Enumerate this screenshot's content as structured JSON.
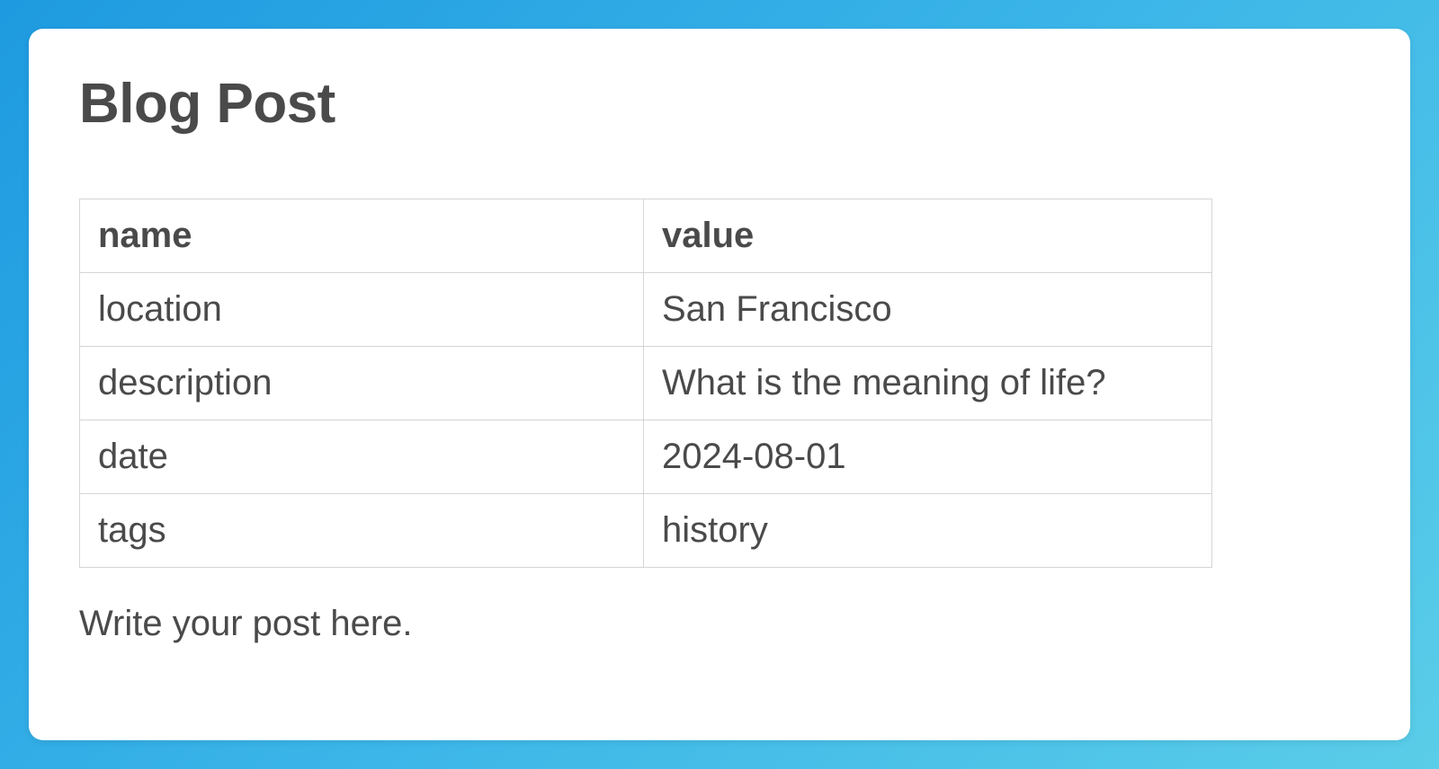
{
  "title": "Blog Post",
  "table": {
    "headers": {
      "name": "name",
      "value": "value"
    },
    "rows": [
      {
        "name": "location",
        "value": "San Francisco"
      },
      {
        "name": "description",
        "value": "What is the meaning of life?"
      },
      {
        "name": "date",
        "value": "2024-08-01"
      },
      {
        "name": "tags",
        "value": "history"
      }
    ]
  },
  "body": "Write your post here."
}
